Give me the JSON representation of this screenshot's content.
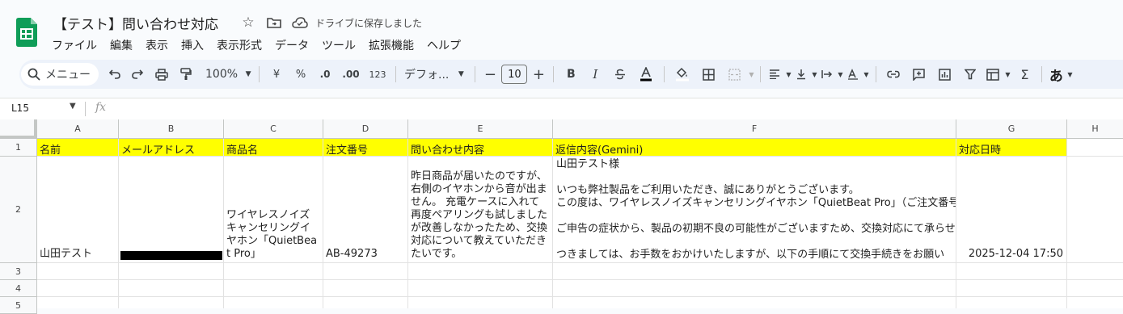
{
  "doc": {
    "title": "【テスト】問い合わせ対応",
    "save_status": "ドライブに保存しました"
  },
  "menu": [
    "ファイル",
    "編集",
    "表示",
    "挿入",
    "表示形式",
    "データ",
    "ツール",
    "拡張機能",
    "ヘルプ"
  ],
  "toolbar": {
    "search_label": "メニュー",
    "zoom": "100%",
    "currency": "¥",
    "percent": "%",
    "dec_decrease": ".0",
    "dec_increase": ".00",
    "format_123": "123",
    "font": "デフォ...",
    "font_size": "10",
    "bold": "B",
    "italic": "I",
    "ime": "あ"
  },
  "formula_bar": {
    "cell_ref": "L15",
    "fx": "fx"
  },
  "columns": [
    "A",
    "B",
    "C",
    "D",
    "E",
    "F",
    "G",
    "H"
  ],
  "rows": [
    "1",
    "2",
    "3",
    "4",
    "5"
  ],
  "headers": {
    "A": "名前",
    "B": "メールアドレス",
    "C": "商品名",
    "D": "注文番号",
    "E": "問い合わせ内容",
    "F": "返信内容(Gemini)",
    "G": "対応日時"
  },
  "row2": {
    "A": "山田テスト",
    "C": "ワイヤレスノイズキャンセリングイヤホン「QuietBeat Pro」",
    "D": "AB-49273",
    "E": "昨日商品が届いたのですが、右側のイヤホンから音が出ません。 充電ケースに入れて再度ペアリングも試しましたが改善しなかったため、交換対応について教えていただきたいです。",
    "F": "山田テスト様\n\nいつも弊社製品をご利用いただき、誠にありがとうございます。\nこの度は、ワイヤレスノイズキャンセリングイヤホン「QuietBeat Pro」（ご注文番号\n\nご申告の症状から、製品の初期不良の可能性がございますため、交換対応にて承らせ\n\nつきましては、お手数をおかけいたしますが、以下の手順にて交換手続きをお願い",
    "G": "2025-12-04 17:50"
  },
  "colors": {
    "header_fill": "#ffff00",
    "sheets_green": "#0f9d58"
  }
}
